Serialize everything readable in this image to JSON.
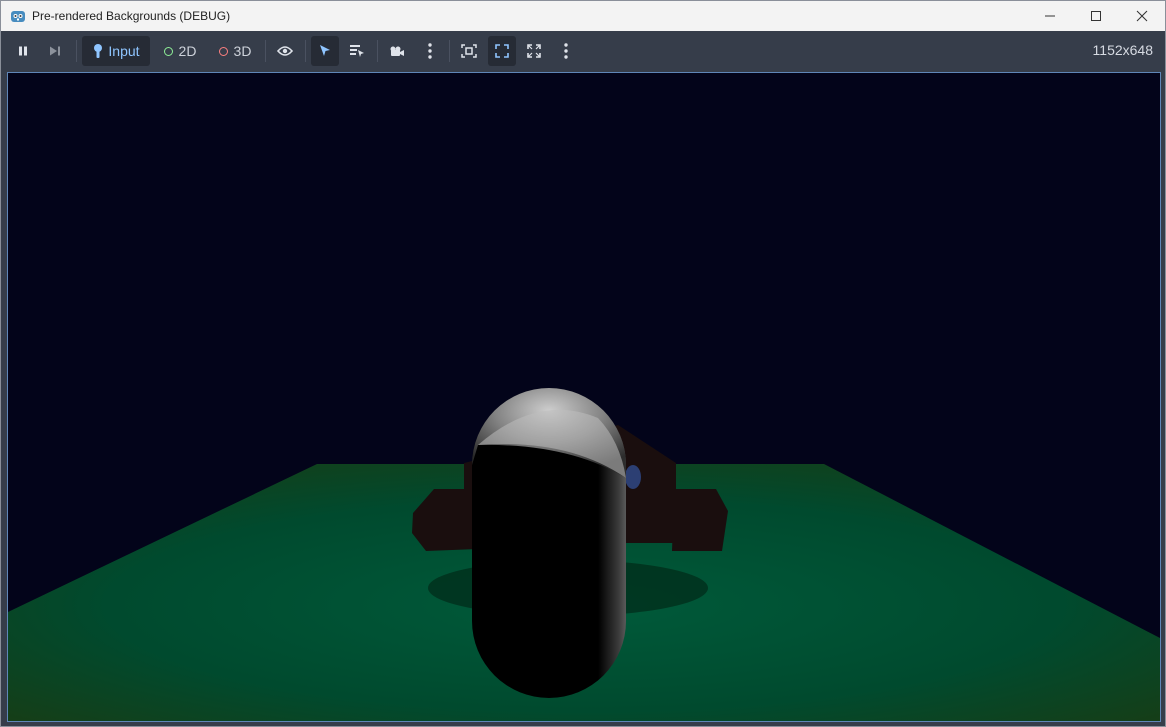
{
  "window": {
    "title": "Pre-rendered Backgrounds (DEBUG)",
    "app_icon": "godot-icon"
  },
  "toolbar": {
    "pause_icon": "pause-icon",
    "next_frame_icon": "next-frame-icon",
    "input_label": "Input",
    "mode_2d_label": "2D",
    "mode_3d_label": "3D",
    "resolution": "1152x648",
    "colors": {
      "input_active": "#8fc5ff",
      "ring_2d": "#8eef97",
      "ring_3d": "#fc7f7f"
    }
  },
  "scene": {
    "background_color": "#03041a",
    "floor_color": "#004a2e",
    "capsule_color": "#000000"
  }
}
